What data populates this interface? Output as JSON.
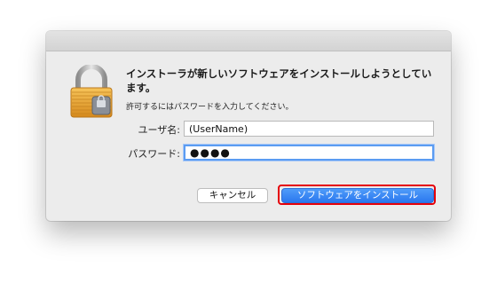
{
  "dialog": {
    "heading": "インストーラが新しいソフトウェアをインストールしようとしています。",
    "subtext": "許可するにはパスワードを入力してください。",
    "username_label": "ユーザ名:",
    "username_value": "(UserName)",
    "password_label": "パスワード:",
    "password_value": "●●●●",
    "cancel_label": "キャンセル",
    "install_label": "ソフトウェアをインストール"
  },
  "icons": {
    "lock": "padlock-icon"
  },
  "colors": {
    "accent": "#2a77ef",
    "highlight": "#e5000a",
    "focus_ring": "#5b9cf2"
  }
}
